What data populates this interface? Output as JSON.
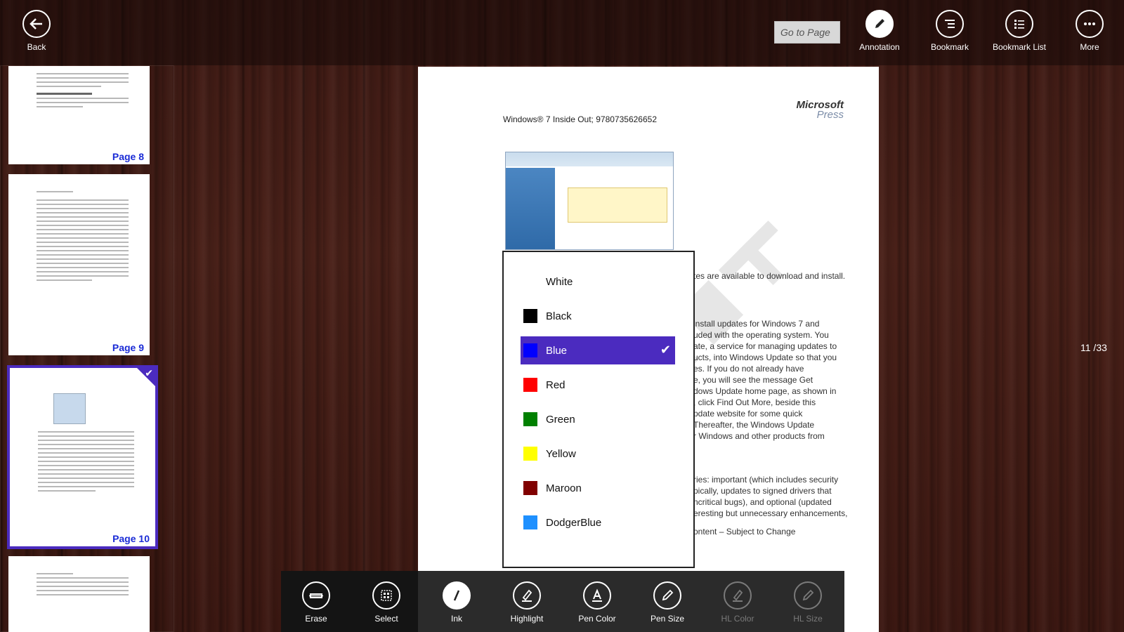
{
  "topbar": {
    "back_label": "Back",
    "goto_label": "Go to Page",
    "annotation_label": "Annotation",
    "bookmark_label": "Bookmark",
    "bookmark_list_label": "Bookmark List",
    "more_label": "More"
  },
  "thumbnails": [
    {
      "label": "Page 8",
      "selected": false
    },
    {
      "label": "Page 9",
      "selected": false
    },
    {
      "label": "Page 10",
      "selected": true
    },
    {
      "label": "",
      "selected": false
    }
  ],
  "page": {
    "header": "Windows® 7 Inside Out; 9780735626652",
    "logo_top": "Microsoft",
    "logo_bottom": "Press",
    "text_lines": [
      "tes are available to download and install.",
      "install updates for Windows 7 and",
      "uded with the operating system. You",
      "ate, a service for managing updates to",
      "ucts, into Windows Update so that you",
      "es. If you do not already have",
      "e, you will see the message Get",
      "dows Update home page, as shown in",
      ", click Find Out More, beside this",
      "pdate website for some quick",
      "Thereafter, the Windows Update",
      "r Windows and other products from",
      "ries: important (which includes security",
      "pically, updates to signed drivers that",
      "ncritical bugs), and optional (updated",
      "eresting but unnecessary enhancements,",
      "ontent – Subject to Change"
    ]
  },
  "page_indicator": "11 /33",
  "color_menu": {
    "items": [
      {
        "label": "White",
        "color": "#ffffff",
        "selected": false
      },
      {
        "label": "Black",
        "color": "#000000",
        "selected": false
      },
      {
        "label": "Blue",
        "color": "#0000ff",
        "selected": true
      },
      {
        "label": "Red",
        "color": "#ff0000",
        "selected": false
      },
      {
        "label": "Green",
        "color": "#008000",
        "selected": false
      },
      {
        "label": "Yellow",
        "color": "#ffff00",
        "selected": false
      },
      {
        "label": "Maroon",
        "color": "#800000",
        "selected": false
      },
      {
        "label": "DodgerBlue",
        "color": "#1e90ff",
        "selected": false
      }
    ],
    "selected_color": "#4b2bbf"
  },
  "bottombar": {
    "erase_label": "Erase",
    "select_label": "Select",
    "ink_label": "Ink",
    "highlight_label": "Highlight",
    "pen_color_label": "Pen Color",
    "pen_size_label": "Pen Size",
    "hl_color_label": "HL Color",
    "hl_size_label": "HL Size"
  },
  "colors": {
    "accent": "#4b2bbf",
    "page_label": "#1a2bd6"
  }
}
